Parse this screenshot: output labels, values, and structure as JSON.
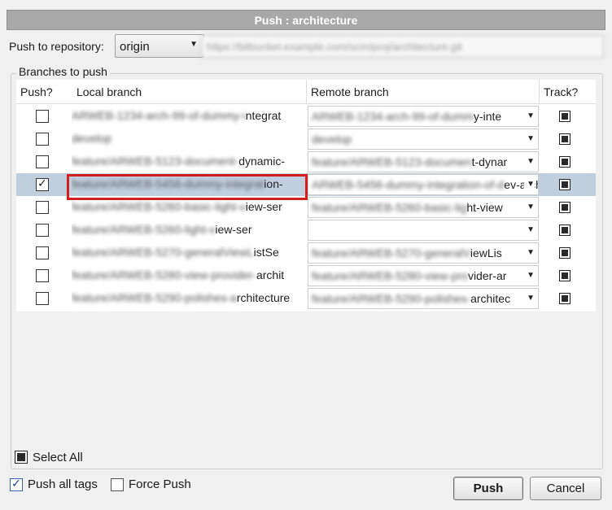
{
  "window": {
    "title": "Push :  architecture"
  },
  "repository": {
    "label": "Push to repository:",
    "selected": "origin",
    "url": "https://bitbucket.example.com/scm/proj/architecture.git"
  },
  "branches": {
    "group_title": "Branches to push",
    "headers": {
      "push": "Push?",
      "local": "Local branch",
      "remote": "Remote branch",
      "track": "Track?"
    },
    "rows": [
      {
        "checked": false,
        "track": true,
        "selected": false,
        "local_blur": "ARWEB-1234-arch-99-of-dummy-i",
        "local_clear": "ntegrat",
        "remote_blur": "ARWEB-1234-arch-99-of-dumm",
        "remote_clear": "y-inte"
      },
      {
        "checked": false,
        "track": true,
        "selected": false,
        "local_blur": "develop",
        "local_clear": "",
        "remote_blur": "develop",
        "remote_clear": ""
      },
      {
        "checked": false,
        "track": true,
        "selected": false,
        "local_blur": "feature/ARWEB-5123-document-",
        "local_clear": "dynamic-",
        "remote_blur": "feature/ARWEB-5123-documen",
        "remote_clear": "t-dynar"
      },
      {
        "checked": true,
        "track": true,
        "selected": true,
        "local_blur": "feature/ARWEB-5456-dummy-integrat",
        "local_clear": "ion-",
        "remote_blur": "ARWEB-5456-dummy-integration-of-d",
        "remote_clear": "ev-arch"
      },
      {
        "checked": false,
        "track": true,
        "selected": false,
        "local_blur": "feature/ARWEB-5260-basic-light-v",
        "local_clear": "iew-ser",
        "remote_blur": "feature/ARWEB-5260-basic-lig",
        "remote_clear": "ht-view"
      },
      {
        "checked": false,
        "track": true,
        "selected": false,
        "local_blur": "feature/ARWEB-5260-light-v",
        "local_clear": "iew-ser",
        "remote_blur": "",
        "remote_clear": ""
      },
      {
        "checked": false,
        "track": true,
        "selected": false,
        "local_blur": "feature/ARWEB-5270-generalViewL",
        "local_clear": "istSe",
        "remote_blur": "feature/ARWEB-5270-generalV",
        "remote_clear": "iewLis"
      },
      {
        "checked": false,
        "track": true,
        "selected": false,
        "local_blur": "feature/ARWEB-5280-view-provider-",
        "local_clear": "archit",
        "remote_blur": "feature/ARWEB-5280-view-pro",
        "remote_clear": "vider-ar"
      },
      {
        "checked": false,
        "track": true,
        "selected": false,
        "local_blur": "feature/ARWEB-5290-polishes-a",
        "local_clear": "rchitecture",
        "remote_blur": "feature/ARWEB-5290-polishes-",
        "remote_clear": "architec"
      }
    ]
  },
  "select_all": {
    "label": "Select All",
    "state": "indeterminate"
  },
  "options": {
    "push_all_tags": {
      "label": "Push all tags",
      "checked": true
    },
    "force_push": {
      "label": "Force Push",
      "checked": false
    }
  },
  "buttons": {
    "push": "Push",
    "cancel": "Cancel"
  }
}
